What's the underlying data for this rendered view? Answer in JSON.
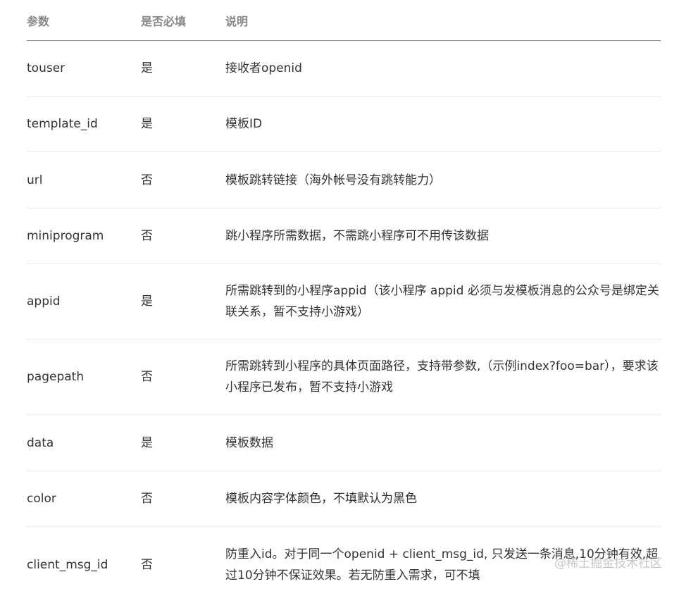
{
  "headers": {
    "param": "参数",
    "required": "是否必填",
    "desc": "说明"
  },
  "rows": [
    {
      "param": "touser",
      "required": "是",
      "desc": "接收者openid"
    },
    {
      "param": "template_id",
      "required": "是",
      "desc": "模板ID"
    },
    {
      "param": "url",
      "required": "否",
      "desc": "模板跳转链接（海外帐号没有跳转能力）"
    },
    {
      "param": "miniprogram",
      "required": "否",
      "desc": "跳小程序所需数据，不需跳小程序可不用传该数据"
    },
    {
      "param": "appid",
      "required": "是",
      "desc": "所需跳转到的小程序appid（该小程序 appid 必须与发模板消息的公众号是绑定关联关系，暂不支持小游戏）"
    },
    {
      "param": "pagepath",
      "required": "否",
      "desc": "所需跳转到小程序的具体页面路径，支持带参数,（示例index?foo=bar），要求该小程序已发布，暂不支持小游戏"
    },
    {
      "param": "data",
      "required": "是",
      "desc": "模板数据"
    },
    {
      "param": "color",
      "required": "否",
      "desc": "模板内容字体颜色，不填默认为黑色"
    },
    {
      "param": "client_msg_id",
      "required": "否",
      "desc": "防重入id。对于同一个openid + client_msg_id, 只发送一条消息,10分钟有效,超过10分钟不保证效果。若无防重入需求，可不填"
    }
  ],
  "watermark": "@稀土掘金技术社区"
}
